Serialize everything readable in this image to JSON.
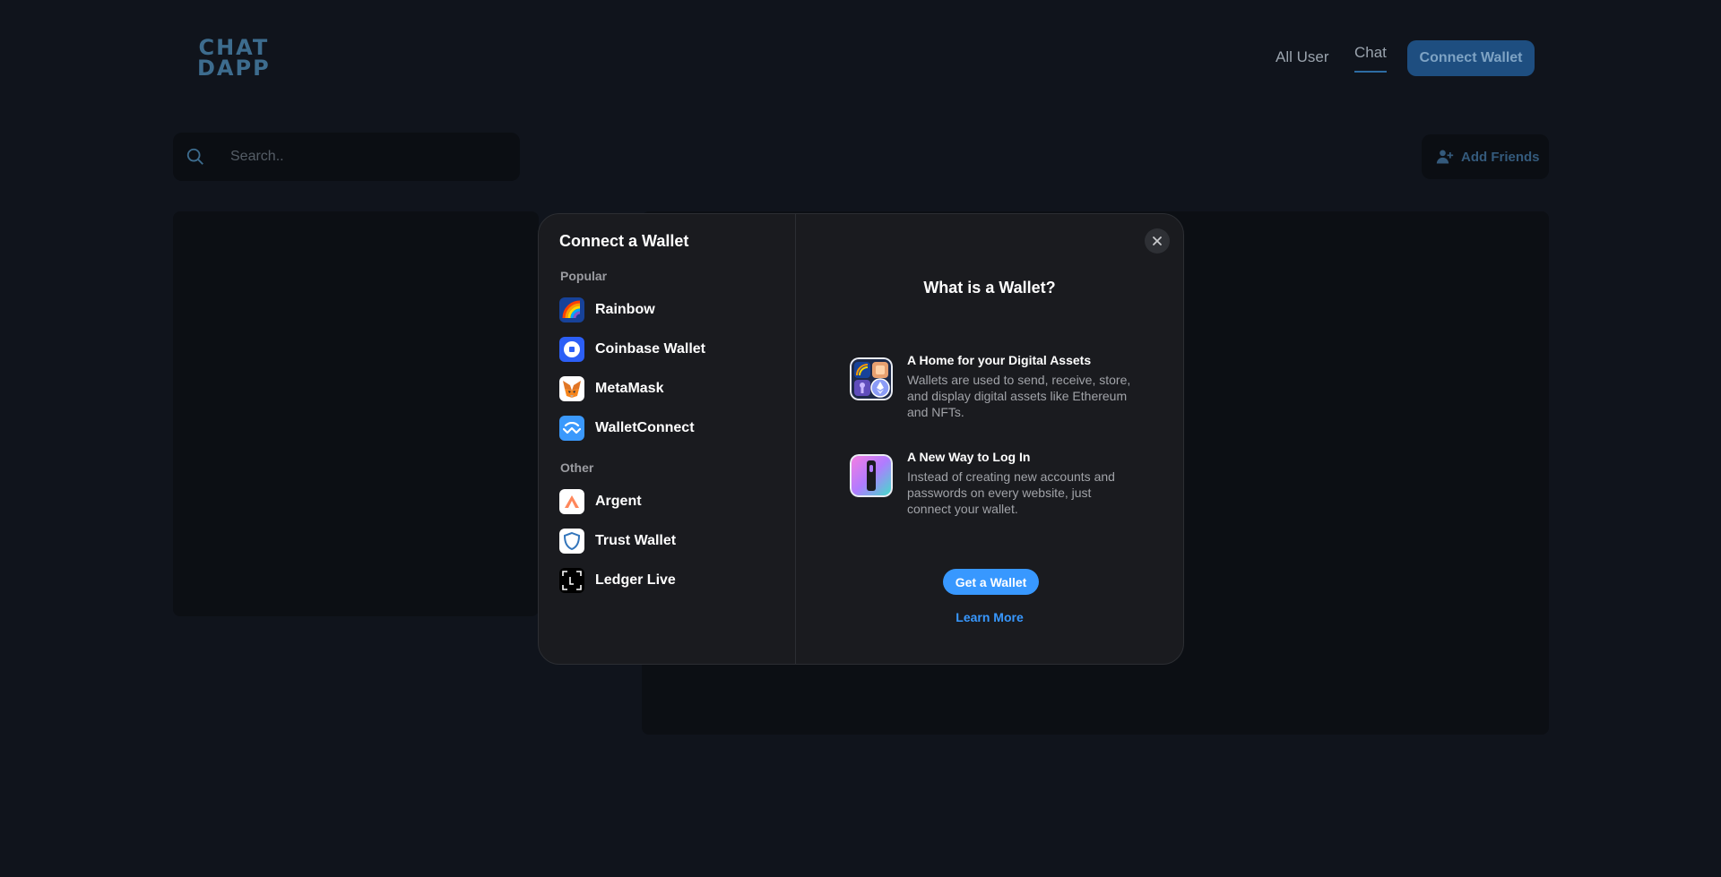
{
  "header": {
    "logo_line1": "CHAT",
    "logo_line2": "DAPP",
    "nav": [
      {
        "label": "All User"
      },
      {
        "label": "Chat"
      }
    ],
    "connect_label": "Connect Wallet"
  },
  "search": {
    "placeholder": "Search.."
  },
  "add_friends_label": "Add Friends",
  "modal": {
    "title": "Connect a Wallet",
    "popular_label": "Popular",
    "other_label": "Other",
    "popular": [
      {
        "name": "Rainbow",
        "icon": "rainbow-icon"
      },
      {
        "name": "Coinbase Wallet",
        "icon": "coinbase-icon"
      },
      {
        "name": "MetaMask",
        "icon": "metamask-fox-icon"
      },
      {
        "name": "WalletConnect",
        "icon": "walletconnect-icon"
      }
    ],
    "other": [
      {
        "name": "Argent",
        "icon": "argent-icon"
      },
      {
        "name": "Trust Wallet",
        "icon": "trust-shield-icon"
      },
      {
        "name": "Ledger Live",
        "icon": "ledger-icon"
      }
    ],
    "right_title": "What is a Wallet?",
    "info": [
      {
        "heading": "A Home for your Digital Assets",
        "text": "Wallets are used to send, receive, store, and display digital assets like Ethereum and NFTs."
      },
      {
        "heading": "A New Way to Log In",
        "text": "Instead of creating new accounts and passwords on every website, just connect your wallet."
      }
    ],
    "get_wallet_label": "Get a Wallet",
    "learn_more_label": "Learn More"
  },
  "colors": {
    "page_bg": "#10141c",
    "modal_bg": "#1a1b1f",
    "accent": "#3898ff",
    "connect_btn": "#1e4e80"
  }
}
